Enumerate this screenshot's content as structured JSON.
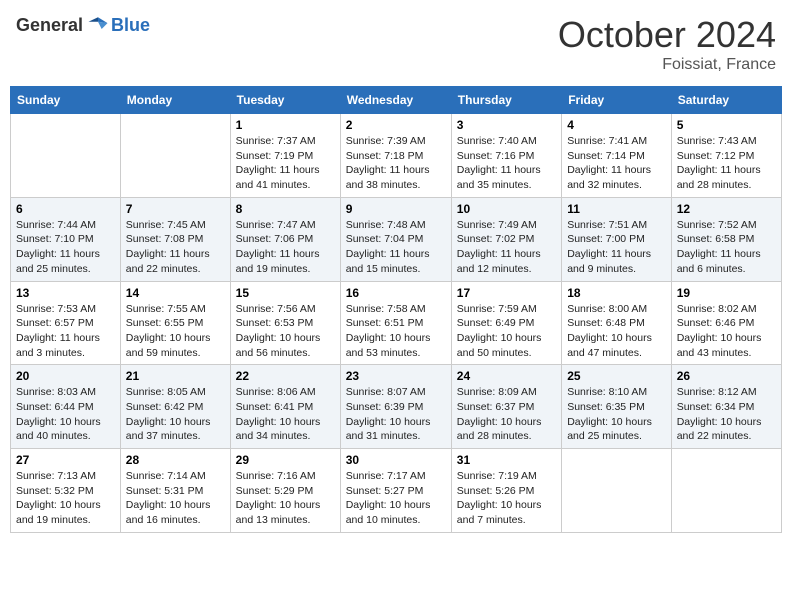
{
  "header": {
    "logo_general": "General",
    "logo_blue": "Blue",
    "month": "October 2024",
    "location": "Foissiat, France"
  },
  "days_of_week": [
    "Sunday",
    "Monday",
    "Tuesday",
    "Wednesday",
    "Thursday",
    "Friday",
    "Saturday"
  ],
  "weeks": [
    [
      {
        "day": "",
        "sunrise": "",
        "sunset": "",
        "daylight": ""
      },
      {
        "day": "",
        "sunrise": "",
        "sunset": "",
        "daylight": ""
      },
      {
        "day": "1",
        "sunrise": "Sunrise: 7:37 AM",
        "sunset": "Sunset: 7:19 PM",
        "daylight": "Daylight: 11 hours and 41 minutes."
      },
      {
        "day": "2",
        "sunrise": "Sunrise: 7:39 AM",
        "sunset": "Sunset: 7:18 PM",
        "daylight": "Daylight: 11 hours and 38 minutes."
      },
      {
        "day": "3",
        "sunrise": "Sunrise: 7:40 AM",
        "sunset": "Sunset: 7:16 PM",
        "daylight": "Daylight: 11 hours and 35 minutes."
      },
      {
        "day": "4",
        "sunrise": "Sunrise: 7:41 AM",
        "sunset": "Sunset: 7:14 PM",
        "daylight": "Daylight: 11 hours and 32 minutes."
      },
      {
        "day": "5",
        "sunrise": "Sunrise: 7:43 AM",
        "sunset": "Sunset: 7:12 PM",
        "daylight": "Daylight: 11 hours and 28 minutes."
      }
    ],
    [
      {
        "day": "6",
        "sunrise": "Sunrise: 7:44 AM",
        "sunset": "Sunset: 7:10 PM",
        "daylight": "Daylight: 11 hours and 25 minutes."
      },
      {
        "day": "7",
        "sunrise": "Sunrise: 7:45 AM",
        "sunset": "Sunset: 7:08 PM",
        "daylight": "Daylight: 11 hours and 22 minutes."
      },
      {
        "day": "8",
        "sunrise": "Sunrise: 7:47 AM",
        "sunset": "Sunset: 7:06 PM",
        "daylight": "Daylight: 11 hours and 19 minutes."
      },
      {
        "day": "9",
        "sunrise": "Sunrise: 7:48 AM",
        "sunset": "Sunset: 7:04 PM",
        "daylight": "Daylight: 11 hours and 15 minutes."
      },
      {
        "day": "10",
        "sunrise": "Sunrise: 7:49 AM",
        "sunset": "Sunset: 7:02 PM",
        "daylight": "Daylight: 11 hours and 12 minutes."
      },
      {
        "day": "11",
        "sunrise": "Sunrise: 7:51 AM",
        "sunset": "Sunset: 7:00 PM",
        "daylight": "Daylight: 11 hours and 9 minutes."
      },
      {
        "day": "12",
        "sunrise": "Sunrise: 7:52 AM",
        "sunset": "Sunset: 6:58 PM",
        "daylight": "Daylight: 11 hours and 6 minutes."
      }
    ],
    [
      {
        "day": "13",
        "sunrise": "Sunrise: 7:53 AM",
        "sunset": "Sunset: 6:57 PM",
        "daylight": "Daylight: 11 hours and 3 minutes."
      },
      {
        "day": "14",
        "sunrise": "Sunrise: 7:55 AM",
        "sunset": "Sunset: 6:55 PM",
        "daylight": "Daylight: 10 hours and 59 minutes."
      },
      {
        "day": "15",
        "sunrise": "Sunrise: 7:56 AM",
        "sunset": "Sunset: 6:53 PM",
        "daylight": "Daylight: 10 hours and 56 minutes."
      },
      {
        "day": "16",
        "sunrise": "Sunrise: 7:58 AM",
        "sunset": "Sunset: 6:51 PM",
        "daylight": "Daylight: 10 hours and 53 minutes."
      },
      {
        "day": "17",
        "sunrise": "Sunrise: 7:59 AM",
        "sunset": "Sunset: 6:49 PM",
        "daylight": "Daylight: 10 hours and 50 minutes."
      },
      {
        "day": "18",
        "sunrise": "Sunrise: 8:00 AM",
        "sunset": "Sunset: 6:48 PM",
        "daylight": "Daylight: 10 hours and 47 minutes."
      },
      {
        "day": "19",
        "sunrise": "Sunrise: 8:02 AM",
        "sunset": "Sunset: 6:46 PM",
        "daylight": "Daylight: 10 hours and 43 minutes."
      }
    ],
    [
      {
        "day": "20",
        "sunrise": "Sunrise: 8:03 AM",
        "sunset": "Sunset: 6:44 PM",
        "daylight": "Daylight: 10 hours and 40 minutes."
      },
      {
        "day": "21",
        "sunrise": "Sunrise: 8:05 AM",
        "sunset": "Sunset: 6:42 PM",
        "daylight": "Daylight: 10 hours and 37 minutes."
      },
      {
        "day": "22",
        "sunrise": "Sunrise: 8:06 AM",
        "sunset": "Sunset: 6:41 PM",
        "daylight": "Daylight: 10 hours and 34 minutes."
      },
      {
        "day": "23",
        "sunrise": "Sunrise: 8:07 AM",
        "sunset": "Sunset: 6:39 PM",
        "daylight": "Daylight: 10 hours and 31 minutes."
      },
      {
        "day": "24",
        "sunrise": "Sunrise: 8:09 AM",
        "sunset": "Sunset: 6:37 PM",
        "daylight": "Daylight: 10 hours and 28 minutes."
      },
      {
        "day": "25",
        "sunrise": "Sunrise: 8:10 AM",
        "sunset": "Sunset: 6:35 PM",
        "daylight": "Daylight: 10 hours and 25 minutes."
      },
      {
        "day": "26",
        "sunrise": "Sunrise: 8:12 AM",
        "sunset": "Sunset: 6:34 PM",
        "daylight": "Daylight: 10 hours and 22 minutes."
      }
    ],
    [
      {
        "day": "27",
        "sunrise": "Sunrise: 7:13 AM",
        "sunset": "Sunset: 5:32 PM",
        "daylight": "Daylight: 10 hours and 19 minutes."
      },
      {
        "day": "28",
        "sunrise": "Sunrise: 7:14 AM",
        "sunset": "Sunset: 5:31 PM",
        "daylight": "Daylight: 10 hours and 16 minutes."
      },
      {
        "day": "29",
        "sunrise": "Sunrise: 7:16 AM",
        "sunset": "Sunset: 5:29 PM",
        "daylight": "Daylight: 10 hours and 13 minutes."
      },
      {
        "day": "30",
        "sunrise": "Sunrise: 7:17 AM",
        "sunset": "Sunset: 5:27 PM",
        "daylight": "Daylight: 10 hours and 10 minutes."
      },
      {
        "day": "31",
        "sunrise": "Sunrise: 7:19 AM",
        "sunset": "Sunset: 5:26 PM",
        "daylight": "Daylight: 10 hours and 7 minutes."
      },
      {
        "day": "",
        "sunrise": "",
        "sunset": "",
        "daylight": ""
      },
      {
        "day": "",
        "sunrise": "",
        "sunset": "",
        "daylight": ""
      }
    ]
  ]
}
